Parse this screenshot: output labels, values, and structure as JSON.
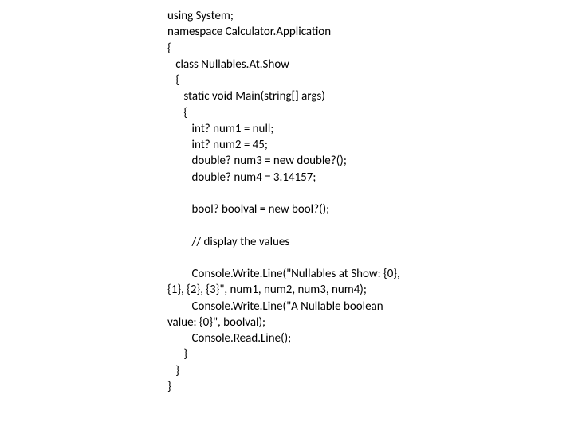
{
  "code": {
    "l1": "using System;",
    "l2": "namespace Calculator.Application",
    "l3": "{",
    "l4": "   class Nullables.At.Show",
    "l5": "   {",
    "l6": "      static void Main(string[] args)",
    "l7": "      {",
    "l8": "         int? num1 = null;",
    "l9": "         int? num2 = 45;",
    "l10": "         double? num3 = new double?();",
    "l11": "         double? num4 = 3.14157;",
    "l12": "",
    "l13": "         bool? boolval = new bool?();",
    "l14": "",
    "l15": "         // display the values",
    "l16": "",
    "l17": "         Console.Write.Line(\"Nullables at Show: {0}, {1}, {2}, {3}\", num1, num2, num3, num4);",
    "l18": "         Console.Write.Line(\"A Nullable boolean value: {0}\", boolval);",
    "l19": "         Console.Read.Line();",
    "l20": "      }",
    "l21": "   }",
    "l22": "}"
  }
}
